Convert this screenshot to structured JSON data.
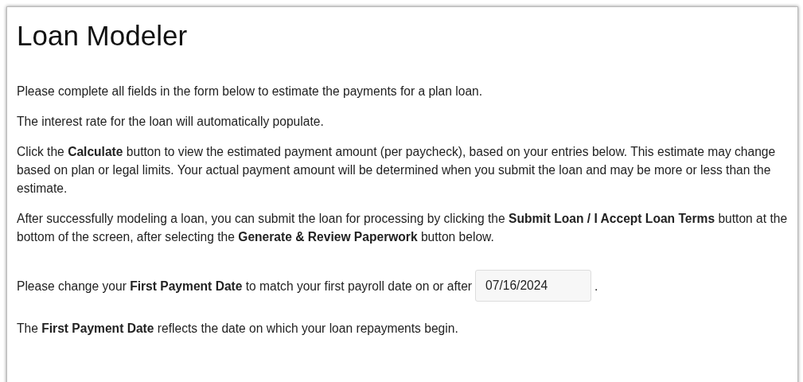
{
  "title": "Loan Modeler",
  "intro": [
    "Please complete all fields in the form below to estimate the payments for a plan loan.",
    "The interest rate for the loan will automatically populate.",
    "Click the **Calculate** button to view the estimated payment amount (per paycheck), based on your entries below. This estimate may change based on plan or legal limits. Your actual payment amount will be determined when you submit the loan and may be more or less than the estimate.",
    "After successfully modeling a loan, you can submit the loan for processing by clicking the **Submit Loan / I Accept Loan Terms** button at the bottom of the screen, after selecting the **Generate & Review Paperwork** button below."
  ],
  "date_prompt": {
    "text_before": "Please change your **First Payment Date** to match your first payroll date on or after",
    "value": "07/16/2024",
    "text_after": "."
  },
  "note": "The **First Payment Date** reflects the date on which your loan repayments begin."
}
